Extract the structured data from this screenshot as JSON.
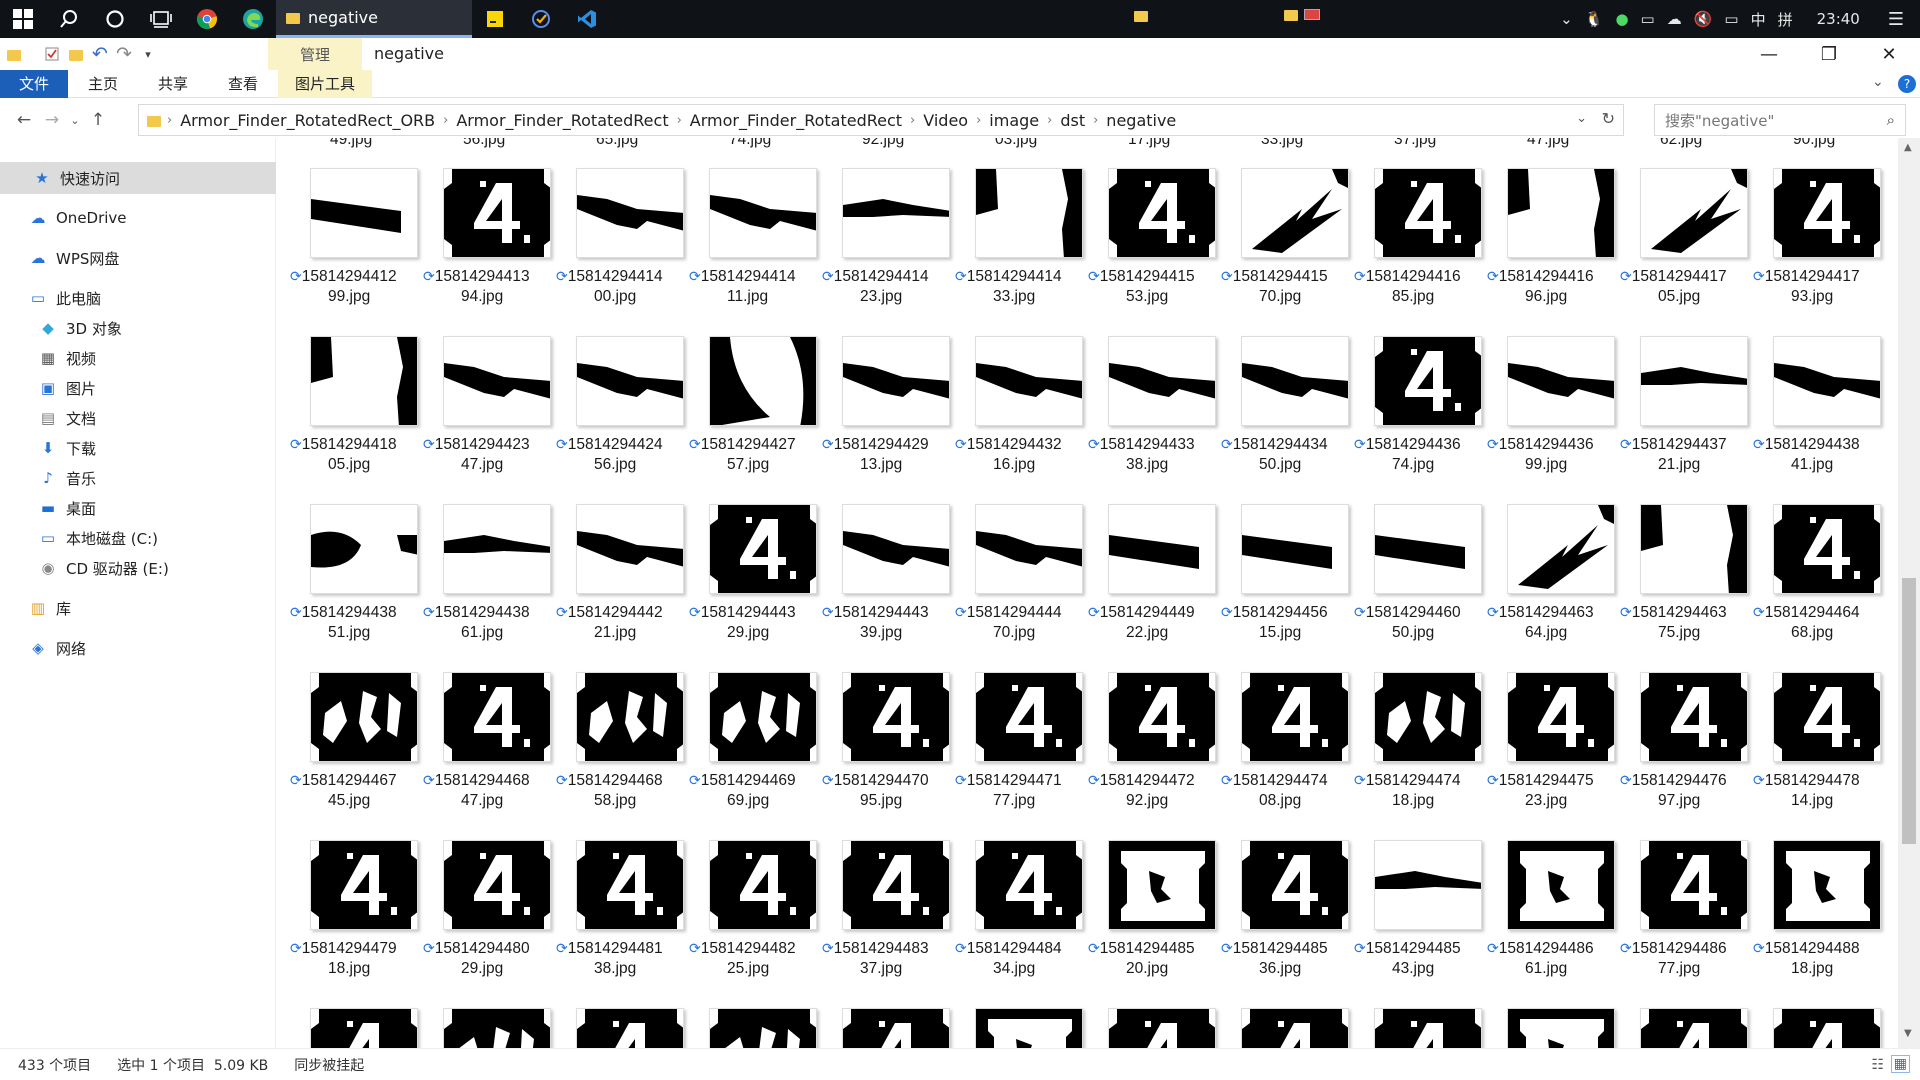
{
  "taskbar": {
    "active_window": "negative",
    "clock": "23:40",
    "ime": "中",
    "ime_mode": "拼",
    "tray_icons": [
      "chevron-up-icon",
      "qq-icon",
      "wechat-icon",
      "network-icon",
      "cloud-icon",
      "mute-icon",
      "battery-icon"
    ]
  },
  "window": {
    "context_tab": "管理",
    "title": "negative"
  },
  "ribbon": {
    "tabs": [
      "文件",
      "主页",
      "共享",
      "查看",
      "图片工具"
    ]
  },
  "address": {
    "crumbs": [
      "Armor_Finder_RotatedRect_ORB",
      "Armor_Finder_RotatedRect",
      "Armor_Finder_RotatedRect",
      "Video",
      "image",
      "dst",
      "negative"
    ],
    "search_placeholder": "搜索\"negative\""
  },
  "nav": {
    "items": [
      {
        "label": "快速访问",
        "icon": "star-icon"
      },
      {
        "label": "OneDrive",
        "icon": "cloud-icon"
      },
      {
        "label": "WPS网盘",
        "icon": "cloud-icon"
      },
      {
        "label": "此电脑",
        "icon": "computer-icon"
      },
      {
        "label": "3D 对象",
        "icon": "cube-icon"
      },
      {
        "label": "视频",
        "icon": "video-icon"
      },
      {
        "label": "图片",
        "icon": "picture-icon"
      },
      {
        "label": "文档",
        "icon": "document-icon"
      },
      {
        "label": "下载",
        "icon": "download-icon"
      },
      {
        "label": "音乐",
        "icon": "music-icon"
      },
      {
        "label": "桌面",
        "icon": "desktop-icon"
      },
      {
        "label": "本地磁盘 (C:)",
        "icon": "drive-icon"
      },
      {
        "label": "CD 驱动器 (E:)",
        "icon": "cd-icon"
      },
      {
        "label": "库",
        "icon": "library-icon"
      },
      {
        "label": "网络",
        "icon": "network-icon"
      }
    ]
  },
  "files": {
    "top_partial": [
      "49.jpg",
      "56.jpg",
      "65.jpg",
      "74.jpg",
      "92.jpg",
      "03.jpg",
      "17.jpg",
      "33.jpg",
      "37.jpg",
      "47.jpg",
      "62.jpg",
      "90.jpg"
    ],
    "rows": [
      [
        {
          "a": "15814294412",
          "b": "99.jpg",
          "t": "bar"
        },
        {
          "a": "15814294413",
          "b": "94.jpg",
          "t": "four"
        },
        {
          "a": "15814294414",
          "b": "00.jpg",
          "t": "slant"
        },
        {
          "a": "15814294414",
          "b": "11.jpg",
          "t": "slant"
        },
        {
          "a": "15814294414",
          "b": "23.jpg",
          "t": "thin"
        },
        {
          "a": "15814294414",
          "b": "33.jpg",
          "t": "corner"
        },
        {
          "a": "15814294415",
          "b": "53.jpg",
          "t": "four"
        },
        {
          "a": "15814294415",
          "b": "70.jpg",
          "t": "shards"
        },
        {
          "a": "15814294416",
          "b": "85.jpg",
          "t": "four"
        },
        {
          "a": "15814294416",
          "b": "96.jpg",
          "t": "corner"
        },
        {
          "a": "15814294417",
          "b": "05.jpg",
          "t": "shards"
        },
        {
          "a": "15814294417",
          "b": "93.jpg",
          "t": "four"
        }
      ],
      [
        {
          "a": "15814294418",
          "b": "05.jpg",
          "t": "corner"
        },
        {
          "a": "15814294423",
          "b": "47.jpg",
          "t": "slant"
        },
        {
          "a": "15814294424",
          "b": "56.jpg",
          "t": "slant"
        },
        {
          "a": "15814294427",
          "b": "57.jpg",
          "t": "arc"
        },
        {
          "a": "15814294429",
          "b": "13.jpg",
          "t": "slant"
        },
        {
          "a": "15814294432",
          "b": "16.jpg",
          "t": "slant"
        },
        {
          "a": "15814294433",
          "b": "38.jpg",
          "t": "slant"
        },
        {
          "a": "15814294434",
          "b": "50.jpg",
          "t": "slant"
        },
        {
          "a": "15814294436",
          "b": "74.jpg",
          "t": "four"
        },
        {
          "a": "15814294436",
          "b": "99.jpg",
          "t": "slant"
        },
        {
          "a": "15814294437",
          "b": "21.jpg",
          "t": "thin"
        },
        {
          "a": "15814294438",
          "b": "41.jpg",
          "t": "slant"
        }
      ],
      [
        {
          "a": "15814294438",
          "b": "51.jpg",
          "t": "blob"
        },
        {
          "a": "15814294438",
          "b": "61.jpg",
          "t": "thin"
        },
        {
          "a": "15814294442",
          "b": "21.jpg",
          "t": "slant"
        },
        {
          "a": "15814294443",
          "b": "29.jpg",
          "t": "four"
        },
        {
          "a": "15814294443",
          "b": "39.jpg",
          "t": "slant"
        },
        {
          "a": "15814294444",
          "b": "70.jpg",
          "t": "slant"
        },
        {
          "a": "15814294449",
          "b": "22.jpg",
          "t": "bar"
        },
        {
          "a": "15814294456",
          "b": "15.jpg",
          "t": "bar"
        },
        {
          "a": "15814294460",
          "b": "50.jpg",
          "t": "bar"
        },
        {
          "a": "15814294463",
          "b": "64.jpg",
          "t": "shards"
        },
        {
          "a": "15814294463",
          "b": "75.jpg",
          "t": "corner"
        },
        {
          "a": "15814294464",
          "b": "68.jpg",
          "t": "four"
        }
      ],
      [
        {
          "a": "15814294467",
          "b": "45.jpg",
          "t": "noisy"
        },
        {
          "a": "15814294468",
          "b": "47.jpg",
          "t": "four"
        },
        {
          "a": "15814294468",
          "b": "58.jpg",
          "t": "noisy"
        },
        {
          "a": "15814294469",
          "b": "69.jpg",
          "t": "noisy"
        },
        {
          "a": "15814294470",
          "b": "95.jpg",
          "t": "four"
        },
        {
          "a": "15814294471",
          "b": "77.jpg",
          "t": "four"
        },
        {
          "a": "15814294472",
          "b": "92.jpg",
          "t": "four"
        },
        {
          "a": "15814294474",
          "b": "08.jpg",
          "t": "four"
        },
        {
          "a": "15814294474",
          "b": "18.jpg",
          "t": "noisy"
        },
        {
          "a": "15814294475",
          "b": "23.jpg",
          "t": "four"
        },
        {
          "a": "15814294476",
          "b": "97.jpg",
          "t": "four"
        },
        {
          "a": "15814294478",
          "b": "14.jpg",
          "t": "four"
        }
      ],
      [
        {
          "a": "15814294479",
          "b": "18.jpg",
          "t": "four"
        },
        {
          "a": "15814294480",
          "b": "29.jpg",
          "t": "four"
        },
        {
          "a": "15814294481",
          "b": "38.jpg",
          "t": "four"
        },
        {
          "a": "15814294482",
          "b": "25.jpg",
          "t": "four"
        },
        {
          "a": "15814294483",
          "b": "37.jpg",
          "t": "four"
        },
        {
          "a": "15814294484",
          "b": "34.jpg",
          "t": "four"
        },
        {
          "a": "15814294485",
          "b": "20.jpg",
          "t": "frame"
        },
        {
          "a": "15814294485",
          "b": "36.jpg",
          "t": "four"
        },
        {
          "a": "15814294485",
          "b": "43.jpg",
          "t": "thin"
        },
        {
          "a": "15814294486",
          "b": "61.jpg",
          "t": "frame"
        },
        {
          "a": "15814294486",
          "b": "77.jpg",
          "t": "four"
        },
        {
          "a": "15814294488",
          "b": "18.jpg",
          "t": "frame"
        }
      ]
    ],
    "bottom_partial": [
      "four",
      "noisy",
      "four",
      "noisy",
      "four",
      "frame",
      "four",
      "four",
      "four",
      "frame",
      "four",
      "four"
    ]
  },
  "status": {
    "count": "433 个项目",
    "selection": "选中 1 个项目  5.09 KB",
    "sync": "同步被挂起"
  }
}
